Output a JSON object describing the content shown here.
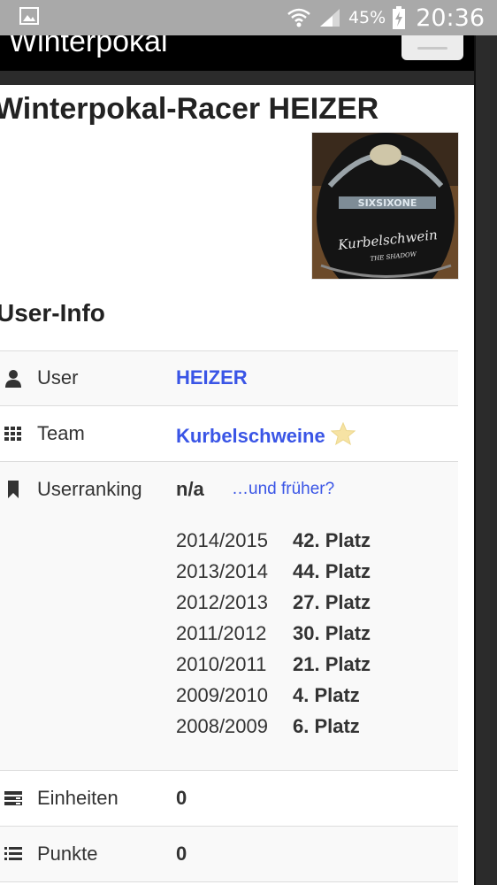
{
  "statusbar": {
    "battery_percent": "45%",
    "clock": "20:36"
  },
  "navbar": {
    "brand": "Winterpokal"
  },
  "page": {
    "title": "Winterpokal-Racer HEIZER",
    "section_title": "User-Info",
    "avatar": {
      "text_line1": "SIXSIXONE",
      "text_line2": "Kurbelschwein",
      "text_line3": "THE SHADOW"
    },
    "rows": {
      "user": {
        "label": "User",
        "value": "HEIZER"
      },
      "team": {
        "label": "Team",
        "value": "Kurbelschweine"
      },
      "userranking": {
        "label": "Userranking",
        "value": "n/a",
        "link": "…und früher?",
        "history": [
          {
            "season": "2014/2015",
            "place": "42. Platz"
          },
          {
            "season": "2013/2014",
            "place": "44. Platz"
          },
          {
            "season": "2012/2013",
            "place": "27. Platz"
          },
          {
            "season": "2011/2012",
            "place": "30. Platz"
          },
          {
            "season": "2010/2011",
            "place": "21. Platz"
          },
          {
            "season": "2009/2010",
            "place": "4. Platz"
          },
          {
            "season": "2008/2009",
            "place": "6. Platz"
          }
        ]
      },
      "einheiten": {
        "label": "Einheiten",
        "value": "0"
      },
      "punkte": {
        "label": "Punkte",
        "value": "0"
      }
    },
    "icons": [
      "user-icon",
      "team-grid-icon",
      "bookmark-icon",
      "units-icon",
      "list-icon",
      "star-icon"
    ],
    "colors": {
      "link": "#3a55e6",
      "navbar": "#000000",
      "statusbar": "#a9a9a9"
    }
  }
}
